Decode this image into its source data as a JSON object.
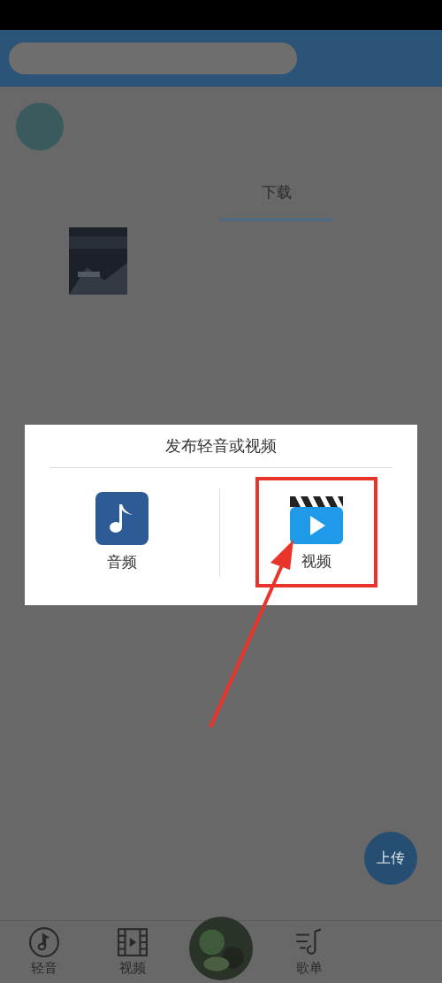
{
  "tabs": {
    "active_label": "下载"
  },
  "dialog": {
    "title": "发布轻音或视频",
    "options": [
      {
        "kind": "audio",
        "label": "音频",
        "highlighted": false
      },
      {
        "kind": "video",
        "label": "视频",
        "highlighted": true
      }
    ]
  },
  "upload_button": {
    "label": "上传"
  },
  "bottom_nav": [
    {
      "kind": "note",
      "label": "轻音"
    },
    {
      "kind": "film",
      "label": "视频"
    },
    {
      "kind": "disc"
    },
    {
      "kind": "playlist",
      "label": "歌单"
    }
  ]
}
